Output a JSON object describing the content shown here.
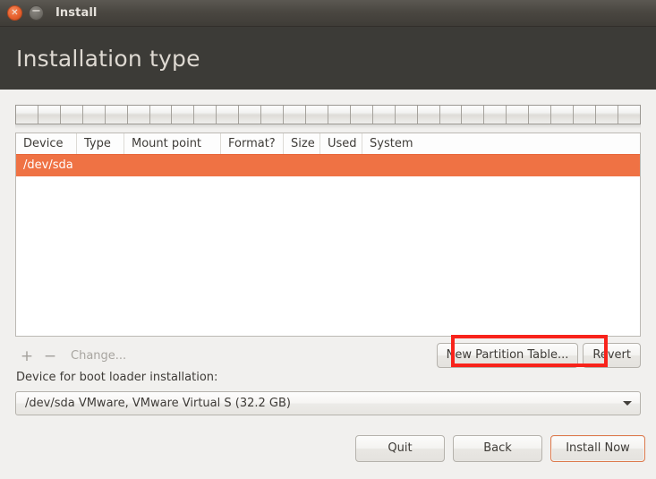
{
  "window": {
    "title": "Install",
    "close_icon": "close-icon",
    "close_glyph": "✕",
    "minimize_icon": "minimize-icon",
    "minimize_glyph": "−"
  },
  "header": {
    "page_title": "Installation type"
  },
  "partition_bar": {
    "segment_count": 28,
    "label": "disk-usage-bar"
  },
  "table": {
    "columns": [
      {
        "label": "Device",
        "key": "device"
      },
      {
        "label": "Type",
        "key": "type"
      },
      {
        "label": "Mount point",
        "key": "mount"
      },
      {
        "label": "Format?",
        "key": "format"
      },
      {
        "label": "Size",
        "key": "size"
      },
      {
        "label": "Used",
        "key": "used"
      },
      {
        "label": "System",
        "key": "system"
      }
    ],
    "rows": [
      {
        "device": "/dev/sda",
        "type": "",
        "mount": "",
        "format": "",
        "size": "",
        "used": "",
        "system": "",
        "selected": true
      }
    ],
    "selection_color": "#ef7244"
  },
  "toolbar": {
    "add_label": "+",
    "remove_label": "−",
    "change_label": "Change...",
    "new_partition_table_label": "New Partition Table...",
    "revert_label": "Revert"
  },
  "bootloader": {
    "label": "Device for boot loader installation:",
    "selected_value": "/dev/sda VMware, VMware Virtual S (32.2 GB)",
    "dropdown_icon": "chevron-down-icon"
  },
  "footer": {
    "quit_label": "Quit",
    "back_label": "Back",
    "install_label": "Install Now"
  },
  "annotation": {
    "highlight_color": "#f8231b",
    "target": "New Partition Table..."
  }
}
